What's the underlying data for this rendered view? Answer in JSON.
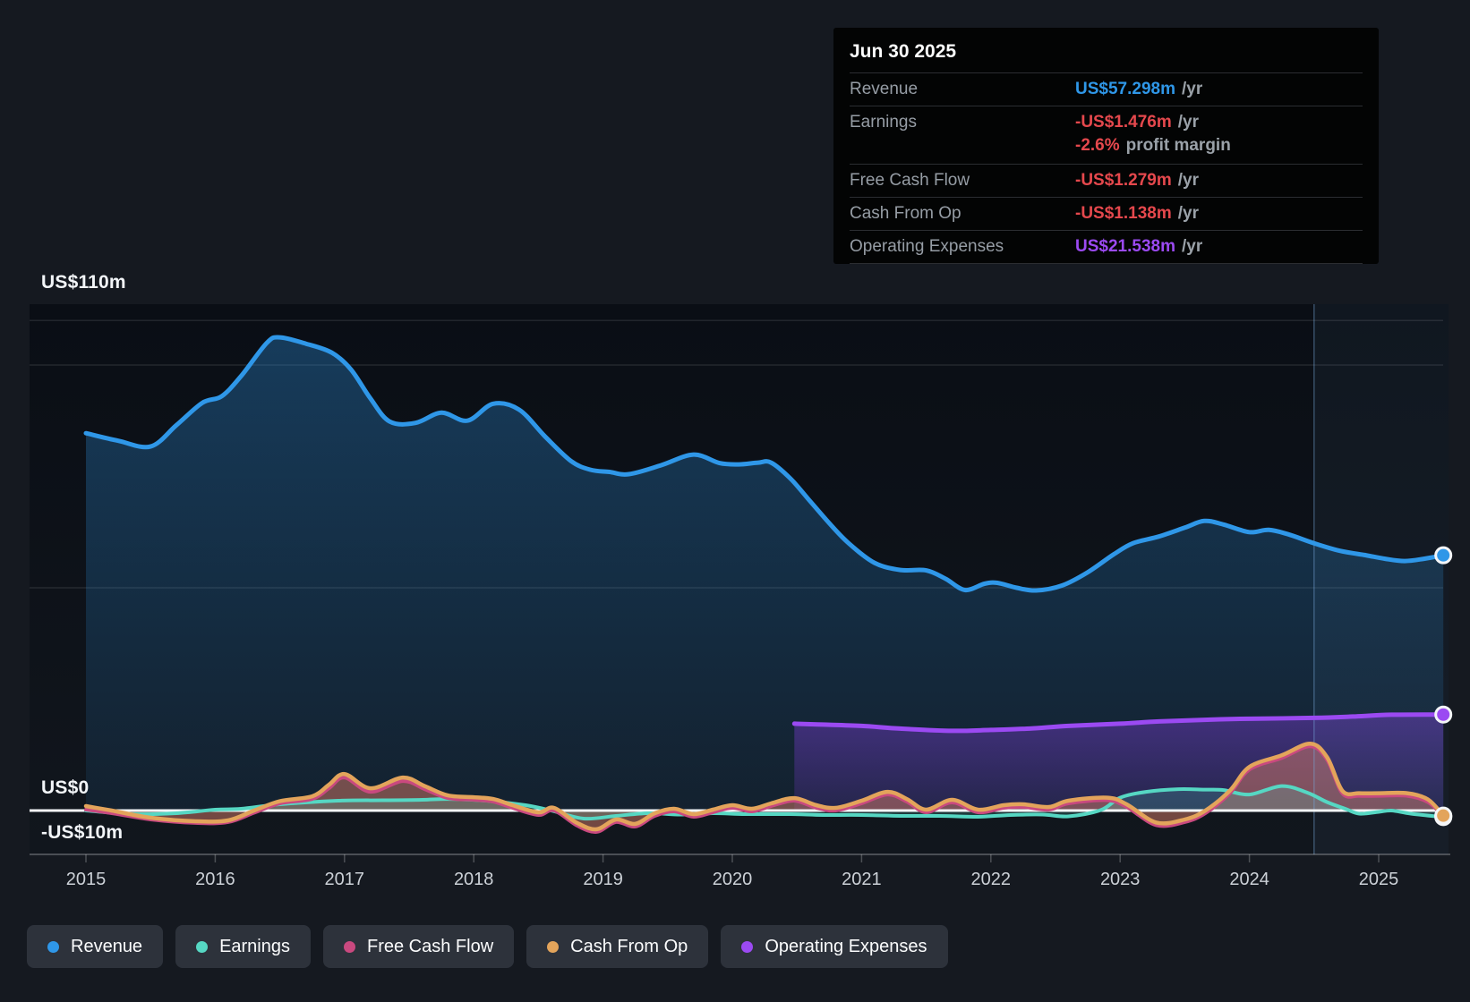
{
  "page": {
    "background": "#151920"
  },
  "tooltip": {
    "date": "Jun 30 2025",
    "rows": [
      {
        "label": "Revenue",
        "value": "US$57.298m",
        "suffix": "/yr",
        "color_key": "revenue"
      },
      {
        "label": "Earnings",
        "value": "-US$1.476m",
        "suffix": "/yr",
        "color_key": "negative",
        "sub_value": "-2.6%",
        "sub_text": "profit margin"
      },
      {
        "label": "Free Cash Flow",
        "value": "-US$1.279m",
        "suffix": "/yr",
        "color_key": "negative"
      },
      {
        "label": "Cash From Op",
        "value": "-US$1.138m",
        "suffix": "/yr",
        "color_key": "negative"
      },
      {
        "label": "Operating Expenses",
        "value": "US$21.538m",
        "suffix": "/yr",
        "color_key": "opex"
      }
    ]
  },
  "axes": {
    "y_labels": [
      "US$110m",
      "US$0",
      "-US$10m"
    ],
    "x_labels": [
      "2015",
      "2016",
      "2017",
      "2018",
      "2019",
      "2020",
      "2021",
      "2022",
      "2023",
      "2024",
      "2025"
    ]
  },
  "legend": [
    {
      "label": "Revenue",
      "color_key": "revenue"
    },
    {
      "label": "Earnings",
      "color_key": "earnings"
    },
    {
      "label": "Free Cash Flow",
      "color_key": "fcf"
    },
    {
      "label": "Cash From Op",
      "color_key": "cashop"
    },
    {
      "label": "Operating Expenses",
      "color_key": "opex"
    }
  ],
  "colors": {
    "revenue": "#2F97E8",
    "earnings": "#56D7C3",
    "fcf": "#C9497F",
    "cashop": "#E3A45B",
    "opex": "#9B4AF2",
    "negative": "#E5484D",
    "grid": "rgba(255,255,255,0.10)",
    "zero_line": "#F2F5F7",
    "axis_line": "rgba(255,255,255,0.24)",
    "band_fill": "rgba(125,175,225,0.06)",
    "band_edge": "rgba(120,170,220,0.40)"
  },
  "chart_data": {
    "type": "line",
    "unit": "US$ millions per year",
    "x_range": [
      2015,
      2025.5
    ],
    "y_range": [
      -10,
      110
    ],
    "y_gridlines": [
      110,
      100,
      50,
      0,
      -10
    ],
    "highlight_band_start": 2024.5,
    "legend_position": "bottom",
    "series": [
      {
        "name": "Revenue",
        "color_key": "revenue",
        "points": [
          [
            2015.0,
            84.7
          ],
          [
            2015.25,
            83.0
          ],
          [
            2015.5,
            81.7
          ],
          [
            2015.7,
            86.5
          ],
          [
            2015.9,
            91.5
          ],
          [
            2016.05,
            93.0
          ],
          [
            2016.2,
            97.5
          ],
          [
            2016.4,
            105.0
          ],
          [
            2016.5,
            106.2
          ],
          [
            2016.7,
            104.8
          ],
          [
            2016.9,
            102.8
          ],
          [
            2017.05,
            99.0
          ],
          [
            2017.2,
            92.5
          ],
          [
            2017.35,
            87.3
          ],
          [
            2017.55,
            87.0
          ],
          [
            2017.75,
            89.3
          ],
          [
            2017.95,
            87.5
          ],
          [
            2018.15,
            91.3
          ],
          [
            2018.35,
            90.0
          ],
          [
            2018.55,
            84.0
          ],
          [
            2018.75,
            78.5
          ],
          [
            2018.9,
            76.5
          ],
          [
            2019.05,
            76.0
          ],
          [
            2019.2,
            75.5
          ],
          [
            2019.45,
            77.5
          ],
          [
            2019.7,
            79.9
          ],
          [
            2019.9,
            78.0
          ],
          [
            2020.05,
            77.7
          ],
          [
            2020.2,
            78.1
          ],
          [
            2020.3,
            78.1
          ],
          [
            2020.45,
            74.5
          ],
          [
            2020.6,
            69.5
          ],
          [
            2020.75,
            64.5
          ],
          [
            2020.9,
            60.0
          ],
          [
            2021.1,
            55.6
          ],
          [
            2021.3,
            54.0
          ],
          [
            2021.5,
            53.9
          ],
          [
            2021.65,
            52.0
          ],
          [
            2021.8,
            49.5
          ],
          [
            2021.95,
            50.9
          ],
          [
            2022.05,
            51.1
          ],
          [
            2022.2,
            50.0
          ],
          [
            2022.35,
            49.4
          ],
          [
            2022.55,
            50.5
          ],
          [
            2022.75,
            53.5
          ],
          [
            2022.95,
            57.5
          ],
          [
            2023.1,
            60.0
          ],
          [
            2023.3,
            61.5
          ],
          [
            2023.5,
            63.5
          ],
          [
            2023.65,
            65.0
          ],
          [
            2023.8,
            64.2
          ],
          [
            2024.0,
            62.5
          ],
          [
            2024.15,
            63.0
          ],
          [
            2024.3,
            62.0
          ],
          [
            2024.5,
            60.0
          ],
          [
            2024.7,
            58.3
          ],
          [
            2024.9,
            57.3
          ],
          [
            2025.05,
            56.5
          ],
          [
            2025.2,
            56.0
          ],
          [
            2025.35,
            56.5
          ],
          [
            2025.5,
            57.298
          ]
        ]
      },
      {
        "name": "Earnings",
        "color_key": "earnings",
        "points": [
          [
            2015.0,
            0.0
          ],
          [
            2015.35,
            -0.8
          ],
          [
            2015.7,
            -0.6
          ],
          [
            2016.0,
            0.2
          ],
          [
            2016.2,
            0.4
          ],
          [
            2016.5,
            1.4
          ],
          [
            2016.95,
            2.2
          ],
          [
            2017.3,
            2.3
          ],
          [
            2017.6,
            2.4
          ],
          [
            2017.8,
            2.6
          ],
          [
            2018.1,
            2.2
          ],
          [
            2018.4,
            1.2
          ],
          [
            2018.6,
            0.0
          ],
          [
            2018.85,
            -1.8
          ],
          [
            2019.1,
            -1.2
          ],
          [
            2019.35,
            -0.6
          ],
          [
            2019.6,
            -0.9
          ],
          [
            2019.85,
            -0.6
          ],
          [
            2020.1,
            -0.8
          ],
          [
            2020.45,
            -0.8
          ],
          [
            2020.7,
            -1.0
          ],
          [
            2021.0,
            -1.0
          ],
          [
            2021.3,
            -1.2
          ],
          [
            2021.6,
            -1.2
          ],
          [
            2021.9,
            -1.4
          ],
          [
            2022.15,
            -1.0
          ],
          [
            2022.4,
            -0.9
          ],
          [
            2022.6,
            -1.3
          ],
          [
            2022.85,
            0.1
          ],
          [
            2023.0,
            2.9
          ],
          [
            2023.2,
            4.2
          ],
          [
            2023.45,
            4.8
          ],
          [
            2023.65,
            4.7
          ],
          [
            2023.8,
            4.6
          ],
          [
            2024.0,
            3.6
          ],
          [
            2024.25,
            5.5
          ],
          [
            2024.45,
            4.0
          ],
          [
            2024.6,
            1.9
          ],
          [
            2024.75,
            0.3
          ],
          [
            2024.85,
            -0.7
          ],
          [
            2025.0,
            -0.3
          ],
          [
            2025.1,
            0.0
          ],
          [
            2025.25,
            -0.7
          ],
          [
            2025.5,
            -1.476
          ]
        ]
      },
      {
        "name": "Free Cash Flow",
        "color_key": "fcf",
        "points": [
          [
            2015.0,
            0.2
          ],
          [
            2015.2,
            -0.6
          ],
          [
            2015.5,
            -2.0
          ],
          [
            2015.85,
            -2.8
          ],
          [
            2016.1,
            -2.6
          ],
          [
            2016.3,
            -0.5
          ],
          [
            2016.5,
            1.6
          ],
          [
            2016.75,
            2.6
          ],
          [
            2016.88,
            5.0
          ],
          [
            2017.0,
            7.4
          ],
          [
            2017.2,
            4.2
          ],
          [
            2017.45,
            6.6
          ],
          [
            2017.62,
            4.8
          ],
          [
            2017.8,
            2.8
          ],
          [
            2018.0,
            2.4
          ],
          [
            2018.15,
            2.0
          ],
          [
            2018.3,
            0.6
          ],
          [
            2018.5,
            -1.0
          ],
          [
            2018.62,
            0.0
          ],
          [
            2018.8,
            -3.4
          ],
          [
            2018.95,
            -4.8
          ],
          [
            2019.1,
            -2.6
          ],
          [
            2019.25,
            -3.6
          ],
          [
            2019.4,
            -1.2
          ],
          [
            2019.55,
            -0.2
          ],
          [
            2019.7,
            -1.4
          ],
          [
            2019.85,
            -0.4
          ],
          [
            2020.0,
            0.6
          ],
          [
            2020.15,
            -0.2
          ],
          [
            2020.3,
            1.0
          ],
          [
            2020.48,
            2.2
          ],
          [
            2020.65,
            0.6
          ],
          [
            2020.8,
            0.0
          ],
          [
            2021.0,
            1.6
          ],
          [
            2021.2,
            3.6
          ],
          [
            2021.35,
            2.0
          ],
          [
            2021.5,
            -0.4
          ],
          [
            2021.7,
            1.8
          ],
          [
            2021.9,
            -0.4
          ],
          [
            2022.1,
            0.6
          ],
          [
            2022.25,
            0.8
          ],
          [
            2022.45,
            0.2
          ],
          [
            2022.6,
            1.6
          ],
          [
            2022.9,
            2.3
          ],
          [
            2023.05,
            0.8
          ],
          [
            2023.28,
            -3.3
          ],
          [
            2023.5,
            -2.6
          ],
          [
            2023.66,
            -0.6
          ],
          [
            2023.85,
            3.9
          ],
          [
            2024.0,
            9.2
          ],
          [
            2024.25,
            11.8
          ],
          [
            2024.47,
            14.4
          ],
          [
            2024.6,
            11.4
          ],
          [
            2024.72,
            3.8
          ],
          [
            2024.85,
            3.3
          ],
          [
            2025.0,
            3.3
          ],
          [
            2025.22,
            3.3
          ],
          [
            2025.38,
            1.9
          ],
          [
            2025.5,
            -1.279
          ]
        ]
      },
      {
        "name": "Cash From Op",
        "color_key": "cashop",
        "points": [
          [
            2015.0,
            1.0
          ],
          [
            2015.2,
            0.0
          ],
          [
            2015.5,
            -1.6
          ],
          [
            2015.85,
            -2.4
          ],
          [
            2016.1,
            -2.2
          ],
          [
            2016.3,
            0.0
          ],
          [
            2016.5,
            2.1
          ],
          [
            2016.75,
            3.2
          ],
          [
            2016.88,
            5.8
          ],
          [
            2017.0,
            8.2
          ],
          [
            2017.2,
            5.0
          ],
          [
            2017.45,
            7.4
          ],
          [
            2017.62,
            5.5
          ],
          [
            2017.8,
            3.4
          ],
          [
            2018.0,
            3.0
          ],
          [
            2018.15,
            2.6
          ],
          [
            2018.3,
            1.2
          ],
          [
            2018.5,
            -0.4
          ],
          [
            2018.62,
            0.6
          ],
          [
            2018.8,
            -2.8
          ],
          [
            2018.95,
            -4.2
          ],
          [
            2019.1,
            -2.0
          ],
          [
            2019.25,
            -3.0
          ],
          [
            2019.4,
            -0.6
          ],
          [
            2019.55,
            0.4
          ],
          [
            2019.7,
            -0.8
          ],
          [
            2019.85,
            0.2
          ],
          [
            2020.0,
            1.2
          ],
          [
            2020.15,
            0.4
          ],
          [
            2020.3,
            1.6
          ],
          [
            2020.48,
            2.8
          ],
          [
            2020.65,
            1.2
          ],
          [
            2020.8,
            0.6
          ],
          [
            2021.0,
            2.2
          ],
          [
            2021.2,
            4.2
          ],
          [
            2021.35,
            2.6
          ],
          [
            2021.5,
            0.2
          ],
          [
            2021.7,
            2.4
          ],
          [
            2021.9,
            0.2
          ],
          [
            2022.1,
            1.2
          ],
          [
            2022.25,
            1.4
          ],
          [
            2022.45,
            0.8
          ],
          [
            2022.6,
            2.2
          ],
          [
            2022.9,
            2.9
          ],
          [
            2023.05,
            1.4
          ],
          [
            2023.28,
            -2.7
          ],
          [
            2023.5,
            -2.0
          ],
          [
            2023.66,
            0.0
          ],
          [
            2023.85,
            4.5
          ],
          [
            2024.0,
            9.8
          ],
          [
            2024.25,
            12.4
          ],
          [
            2024.47,
            15.0
          ],
          [
            2024.6,
            12.0
          ],
          [
            2024.72,
            4.4
          ],
          [
            2024.85,
            3.9
          ],
          [
            2025.0,
            3.9
          ],
          [
            2025.22,
            3.9
          ],
          [
            2025.38,
            2.5
          ],
          [
            2025.5,
            -1.138
          ]
        ]
      },
      {
        "name": "Operating Expenses",
        "color_key": "opex",
        "points": [
          [
            2020.48,
            19.5
          ],
          [
            2020.7,
            19.3
          ],
          [
            2021.0,
            19.0
          ],
          [
            2021.3,
            18.4
          ],
          [
            2021.7,
            17.9
          ],
          [
            2022.0,
            18.1
          ],
          [
            2022.3,
            18.4
          ],
          [
            2022.6,
            19.0
          ],
          [
            2023.0,
            19.5
          ],
          [
            2023.3,
            20.0
          ],
          [
            2023.7,
            20.4
          ],
          [
            2024.0,
            20.6
          ],
          [
            2024.5,
            20.8
          ],
          [
            2024.8,
            21.1
          ],
          [
            2025.1,
            21.5
          ],
          [
            2025.5,
            21.538
          ]
        ]
      }
    ]
  }
}
